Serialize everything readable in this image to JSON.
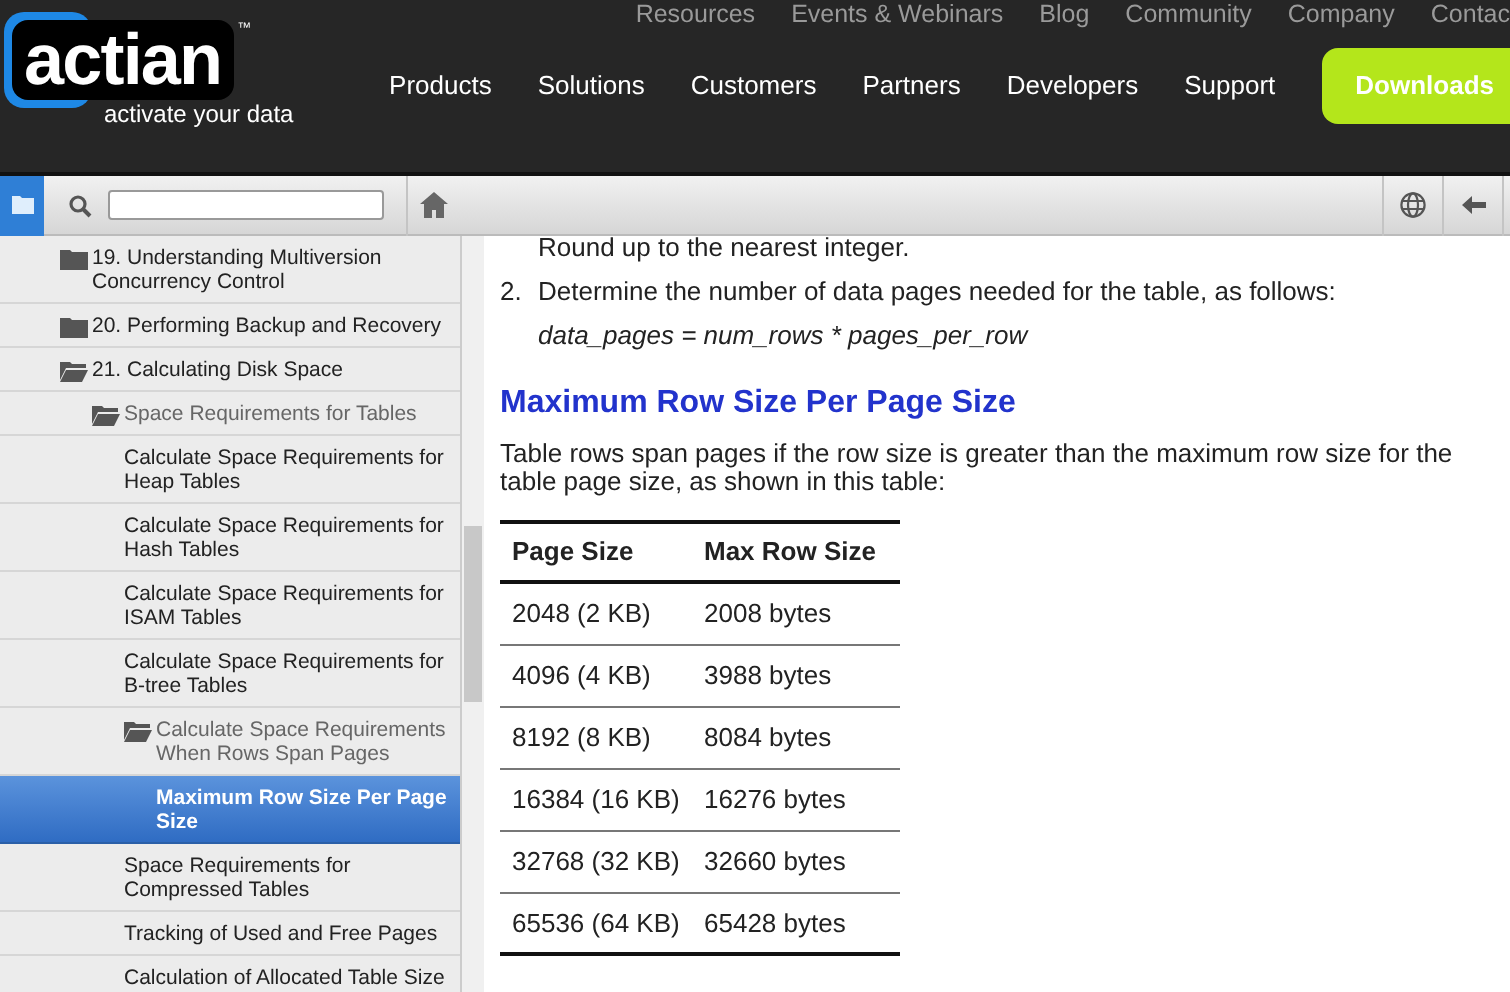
{
  "header": {
    "logo": {
      "word": "actian",
      "tm": "™",
      "tagline": "activate your data"
    },
    "top_links": [
      "Resources",
      "Events & Webinars",
      "Blog",
      "Community",
      "Company",
      "Contac"
    ],
    "nav": [
      "Products",
      "Solutions",
      "Customers",
      "Partners",
      "Developers",
      "Support"
    ],
    "cta": "Downloads"
  },
  "tree": [
    {
      "label": "19. Understanding Multiversion Concurrency Control",
      "kind": "folder",
      "expanded": false,
      "selected": false
    },
    {
      "label": "20. Performing Backup and Recovery",
      "kind": "folder",
      "expanded": false,
      "selected": false
    },
    {
      "label": "21. Calculating Disk Space",
      "kind": "folder",
      "expanded": true,
      "selected": false,
      "children": [
        {
          "label": "Space Requirements for Tables",
          "kind": "folder",
          "expanded": true,
          "selected": false,
          "children": [
            {
              "label": "Calculate Space Requirements for Heap Tables",
              "kind": "page",
              "selected": false
            },
            {
              "label": "Calculate Space Requirements for Hash Tables",
              "kind": "page",
              "selected": false
            },
            {
              "label": "Calculate Space Requirements for ISAM Tables",
              "kind": "page",
              "selected": false
            },
            {
              "label": "Calculate Space Requirements for B-tree Tables",
              "kind": "page",
              "selected": false
            },
            {
              "label": "Calculate Space Requirements When Rows Span Pages",
              "kind": "folder",
              "expanded": true,
              "selected": false,
              "children": [
                {
                  "label": "Maximum Row Size Per Page Size",
                  "kind": "page",
                  "selected": true
                }
              ]
            },
            {
              "label": "Space Requirements for Compressed Tables",
              "kind": "page",
              "selected": false
            },
            {
              "label": "Tracking of Used and Free Pages",
              "kind": "page",
              "selected": false
            },
            {
              "label": "Calculation of Allocated Table Size",
              "kind": "page",
              "selected": false
            }
          ]
        }
      ]
    }
  ],
  "content": {
    "intro_line": "Round up to the nearest integer.",
    "step": {
      "number": "2.",
      "text": "Determine the number of data pages needed for the table, as follows:",
      "formula": "data_pages = num_rows * pages_per_row"
    },
    "heading": "Maximum Row Size Per Page Size",
    "paragraph": "Table rows span pages if the row size is greater than the maximum row size for the table page size, as shown in this table:",
    "table": {
      "columns": [
        "Page Size",
        "Max Row Size"
      ],
      "rows": [
        [
          "2048 (2 KB)",
          "2008 bytes"
        ],
        [
          "4096 (4 KB)",
          "3988 bytes"
        ],
        [
          "8192 (8 KB)",
          "8084 bytes"
        ],
        [
          "16384 (16 KB)",
          "16276 bytes"
        ],
        [
          "32768 (32 KB)",
          "32660 bytes"
        ],
        [
          "65536 (64 KB)",
          "65428 bytes"
        ]
      ]
    }
  }
}
